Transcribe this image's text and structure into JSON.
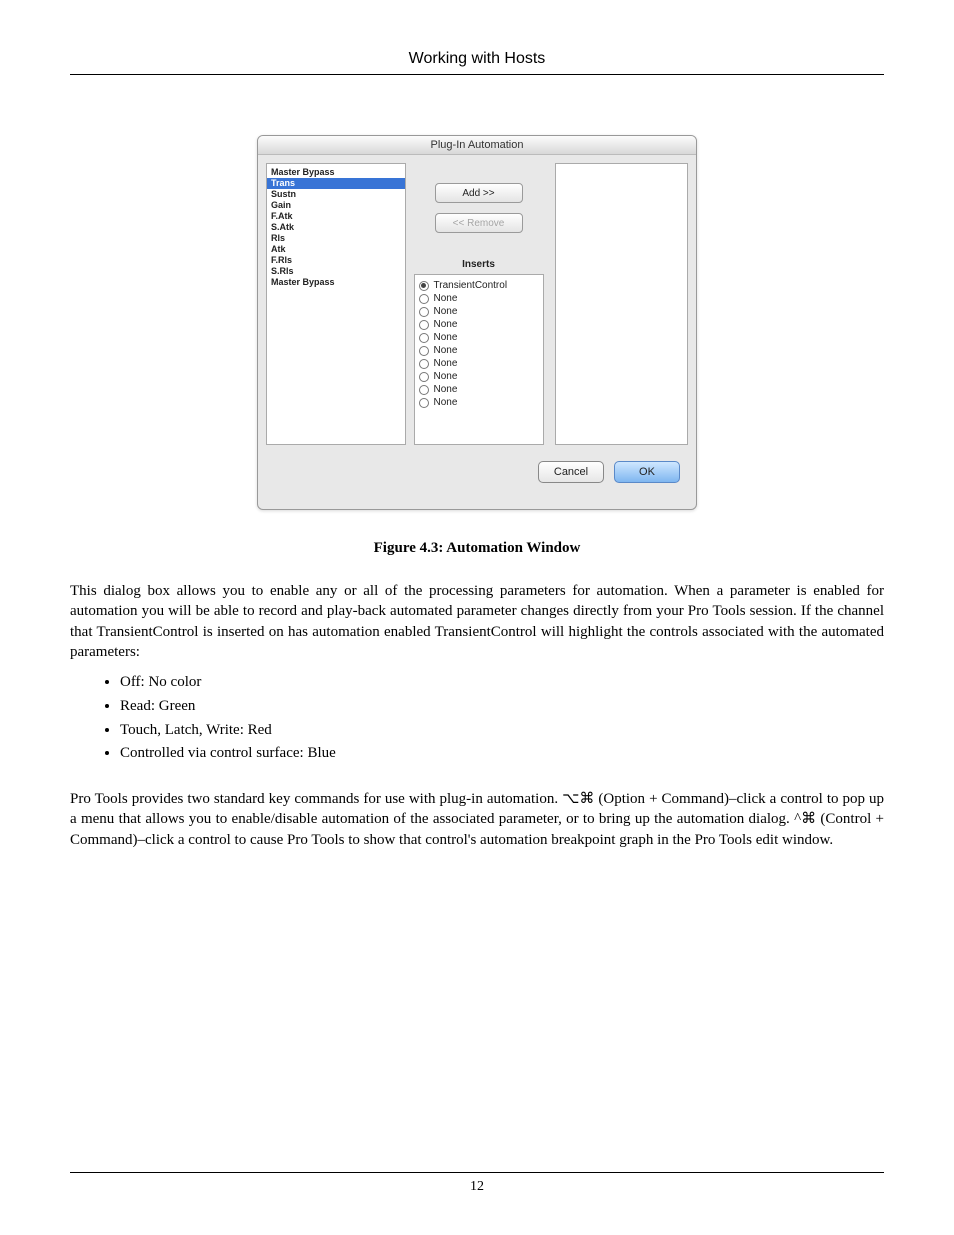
{
  "header": {
    "title": "Working with Hosts"
  },
  "dialog": {
    "title": "Plug-In Automation",
    "left_items": [
      "Master Bypass",
      "Trans",
      "Sustn",
      "Gain",
      "F.Atk",
      "S.Atk",
      "Rls",
      "Atk",
      "F.Rls",
      "S.Rls",
      "Master Bypass"
    ],
    "selected_index": 1,
    "add_btn": "Add >>",
    "remove_btn": "<< Remove",
    "inserts_label": "Inserts",
    "inserts": [
      "TransientControl",
      "None",
      "None",
      "None",
      "None",
      "None",
      "None",
      "None",
      "None",
      "None"
    ],
    "inserts_selected_index": 0,
    "cancel": "Cancel",
    "ok": "OK"
  },
  "caption": "Figure 4.3: Automation Window",
  "para1": "This dialog box allows you to enable any or all of the processing parameters for automation. When a parameter is enabled for automation you will be able to record and play-back automated parameter changes directly from your Pro Tools session. If the channel that TransientControl is inserted on has automation enabled TransientControl will highlight the controls associated with the automated parameters:",
  "bullets": [
    "Off: No color",
    "Read: Green",
    "Touch, Latch, Write: Red",
    "Controlled via control surface: Blue"
  ],
  "para2_a": "Pro Tools provides two standard key commands for use with plug-in automation. ",
  "para2_b": " (Option + Command)–click a control to pop up a menu that allows you to enable/disable automation of the associated parameter, or to bring up the automation dialog. ",
  "para2_c": " (Control + Command)–click a control to cause Pro Tools to show that control's automation breakpoint graph in the Pro Tools edit window.",
  "key1": "⌥⌘",
  "key2": "^⌘",
  "footer": {
    "page": "12"
  }
}
